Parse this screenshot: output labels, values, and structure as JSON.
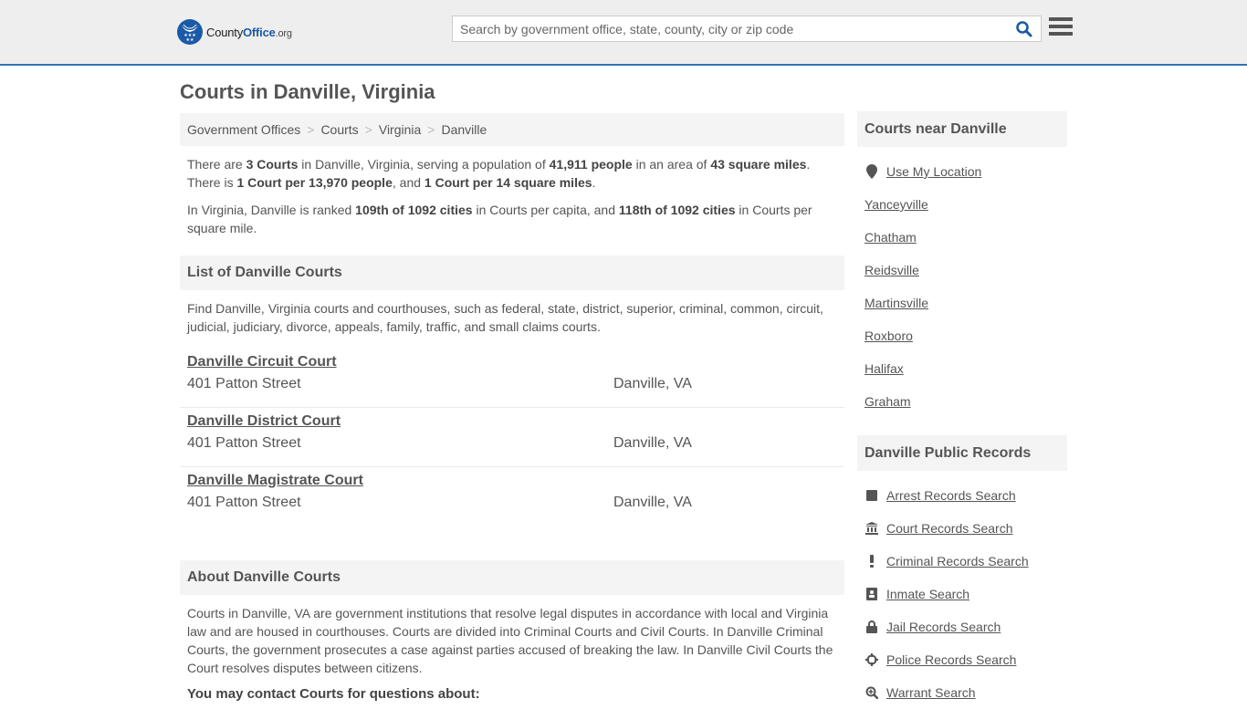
{
  "header": {
    "logo": {
      "county": "County",
      "office": "Office",
      "org": ".org"
    },
    "search": {
      "placeholder": "Search by government office, state, county, city or zip code",
      "value": ""
    },
    "icons": {
      "search": "search-icon",
      "menu": "hamburger-menu-icon",
      "logo": "eagle-stars-logo-icon"
    }
  },
  "page": {
    "title": "Courts in Danville, Virginia"
  },
  "breadcrumb": [
    {
      "label": "Government Offices"
    },
    {
      "label": "Courts"
    },
    {
      "label": "Virginia"
    },
    {
      "label": "Danville"
    }
  ],
  "breadcrumb_separator": ">",
  "summary": {
    "p1": {
      "t1": "There are ",
      "b1": "3 Courts",
      "t2": " in Danville, Virginia, serving a population of ",
      "b2": "41,911 people",
      "t3": " in an area of ",
      "b3": "43 square miles",
      "t4": ". There is ",
      "b4": "1 Court per 13,970 people",
      "t5": ", and ",
      "b5": "1 Court per 14 square miles",
      "t6": "."
    },
    "p2": {
      "t1": "In Virginia, Danville is ranked ",
      "b1": "109th of 1092 cities",
      "t2": " in Courts per capita, and ",
      "b2": "118th of 1092 cities",
      "t3": " in Courts per square mile."
    }
  },
  "list_section": {
    "heading": "List of Danville Courts",
    "intro": "Find Danville, Virginia courts and courthouses, such as federal, state, district, superior, criminal, common, circuit, judicial, judiciary, divorce, appeals, family, traffic, and small claims courts.",
    "courts": [
      {
        "name": "Danville Circuit Court",
        "address": "401 Patton Street",
        "city": "Danville, VA"
      },
      {
        "name": "Danville District Court",
        "address": "401 Patton Street",
        "city": "Danville, VA"
      },
      {
        "name": "Danville Magistrate Court",
        "address": "401 Patton Street",
        "city": "Danville, VA"
      }
    ]
  },
  "about_section": {
    "heading": "About Danville Courts",
    "text": "Courts in Danville, VA are government institutions that resolve legal disputes in accordance with local and Virginia law and are housed in courthouses. Courts are divided into Criminal Courts and Civil Courts. In Danville Criminal Courts, the government prosecutes a case against parties accused of breaking the law. In Danville Civil Courts the Court resolves disputes between citizens.",
    "contact_heading": "You may contact Courts for questions about:"
  },
  "sidebar": {
    "nearby": {
      "heading": "Courts near Danville",
      "use_location": {
        "label": "Use My Location",
        "icon": "map-pin-icon"
      },
      "cities": [
        "Yanceyville",
        "Chatham",
        "Reidsville",
        "Martinsville",
        "Roxboro",
        "Halifax",
        "Graham"
      ]
    },
    "records": {
      "heading": "Danville Public Records",
      "items": [
        {
          "label": "Arrest Records Search",
          "icon": "square-icon"
        },
        {
          "label": "Court Records Search",
          "icon": "courthouse-icon"
        },
        {
          "label": "Criminal Records Search",
          "icon": "exclamation-icon"
        },
        {
          "label": "Inmate Search",
          "icon": "id-badge-icon"
        },
        {
          "label": "Jail Records Search",
          "icon": "lock-icon"
        },
        {
          "label": "Police Records Search",
          "icon": "crosshairs-icon"
        },
        {
          "label": "Warrant Search",
          "icon": "zoom-in-icon"
        }
      ]
    }
  },
  "colors": {
    "brand_blue": "#1a5aa6",
    "header_border": "#2e73b4",
    "text": "#555555",
    "panel_bg": "#f4f4f4",
    "header_bg": "#eeeeee"
  }
}
